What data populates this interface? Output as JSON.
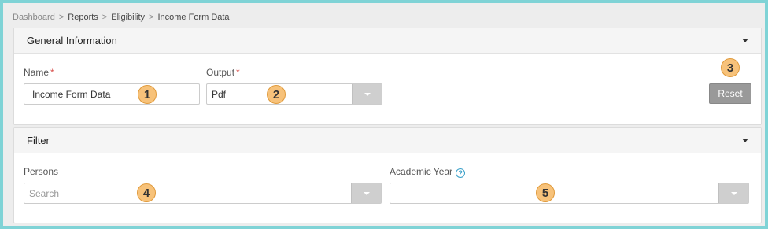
{
  "breadcrumb": {
    "items": [
      "Dashboard",
      "Reports",
      "Eligibility",
      "Income Form Data"
    ],
    "separator": ">"
  },
  "general": {
    "title": "General Information",
    "name_label": "Name",
    "name_value": "Income Form Data",
    "output_label": "Output",
    "output_value": "Pdf",
    "required_mark": "*",
    "reset_label": "Reset"
  },
  "filter": {
    "title": "Filter",
    "persons_label": "Persons",
    "persons_placeholder": "Search",
    "academic_year_label": "Academic Year",
    "academic_year_value": ""
  },
  "callouts": [
    "1",
    "2",
    "3",
    "4",
    "5"
  ],
  "icons": {
    "collapse": "chevron-down-icon",
    "dropdown": "dropdown-arrow-icon",
    "help": "help-circle-icon"
  },
  "colors": {
    "callout_fill": "#f7c27a",
    "frame_border": "#7fd3d6",
    "button_gray": "#999999",
    "required": "#d9534f",
    "help": "#3aa0c9"
  }
}
